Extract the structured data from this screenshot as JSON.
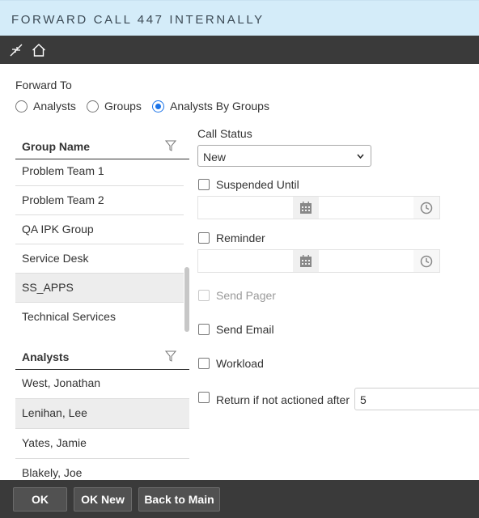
{
  "window": {
    "title": "FORWARD CALL 447 INTERNALLY"
  },
  "toolbar": {
    "icons": [
      "collapse-icon",
      "home-icon"
    ]
  },
  "forward_to": {
    "label": "Forward To",
    "options": [
      {
        "label": "Analysts",
        "selected": false
      },
      {
        "label": "Groups",
        "selected": false
      },
      {
        "label": "Analysts By Groups",
        "selected": true
      }
    ]
  },
  "groups": {
    "header": "Group Name",
    "items": [
      {
        "label": "Problem Team 1",
        "selected": false
      },
      {
        "label": "Problem Team 2",
        "selected": false
      },
      {
        "label": "QA IPK Group",
        "selected": false
      },
      {
        "label": "Service Desk",
        "selected": false
      },
      {
        "label": "SS_APPS",
        "selected": true
      },
      {
        "label": "Technical Services",
        "selected": false
      }
    ]
  },
  "analysts": {
    "header": "Analysts",
    "items": [
      {
        "label": "West, Jonathan",
        "selected": false
      },
      {
        "label": "Lenihan, Lee",
        "selected": true
      },
      {
        "label": "Yates, Jamie",
        "selected": false
      },
      {
        "label": "Blakely, Joe",
        "selected": false
      }
    ]
  },
  "call_status": {
    "label": "Call Status",
    "value": "New"
  },
  "options": {
    "suspended_until": {
      "label": "Suspended Until",
      "checked": false,
      "date": "",
      "time": ""
    },
    "reminder": {
      "label": "Reminder",
      "checked": false,
      "date": "",
      "time": ""
    },
    "send_pager": {
      "label": "Send Pager",
      "checked": false,
      "disabled": true
    },
    "send_email": {
      "label": "Send Email",
      "checked": false
    },
    "workload": {
      "label": "Workload",
      "checked": false
    },
    "return_if_not_actioned": {
      "label": "Return if not actioned after",
      "checked": false,
      "value": "5"
    }
  },
  "footer": {
    "ok": "OK",
    "ok_new": "OK New",
    "back": "Back to Main"
  },
  "colors": {
    "title_bg": "#d4ecf9",
    "toolbar_bg": "#3a3a3a",
    "accent": "#1a73e8"
  }
}
